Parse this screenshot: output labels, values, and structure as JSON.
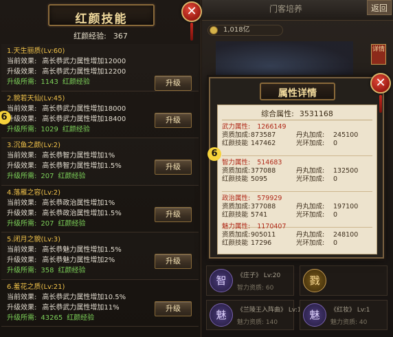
{
  "left_panel": {
    "title": "红颜技能",
    "exp_label": "红颜经验:",
    "exp_value": "367",
    "upgrade_label": "升级",
    "skills": [
      {
        "name": "1.天生丽质(Lv:60)",
        "current_label": "当前效果:",
        "current": "高长恭武力属性增加12000",
        "next_label": "升级效果:",
        "next": "高长恭武力属性增加12200",
        "need_label": "升级所需:",
        "need_value": "1143",
        "need_unit": "红颜经验"
      },
      {
        "name": "2.貌若天仙(Lv:45)",
        "current_label": "当前效果:",
        "current": "高长恭武力属性增加18000",
        "next_label": "升级效果:",
        "next": "高长恭武力属性增加18400",
        "need_label": "升级所需:",
        "need_value": "1029",
        "need_unit": "红颜经验"
      },
      {
        "name": "3.沉鱼之颜(Lv:2)",
        "current_label": "当前效果:",
        "current": "高长恭智力属性增加1%",
        "next_label": "升级效果:",
        "next": "高长恭智力属性增加1.5%",
        "need_label": "升级所需:",
        "need_value": "207",
        "need_unit": "红颜经验"
      },
      {
        "name": "4.落雁之容(Lv:2)",
        "current_label": "当前效果:",
        "current": "高长恭政治属性增加1%",
        "next_label": "升级效果:",
        "next": "高长恭政治属性增加1.5%",
        "need_label": "升级所需:",
        "need_value": "207",
        "need_unit": "红颜经验"
      },
      {
        "name": "5.闭月之貌(Lv:3)",
        "current_label": "当前效果:",
        "current": "高长恭魅力属性增加1.5%",
        "next_label": "升级效果:",
        "next": "高长恭魅力属性增加2%",
        "need_label": "升级所需:",
        "need_value": "358",
        "need_unit": "红颜经验"
      },
      {
        "name": "6.羞花之质(Lv:21)",
        "current_label": "当前效果:",
        "current": "高长恭武力属性增加10.5%",
        "next_label": "升级效果:",
        "next": "高长恭武力属性增加11%",
        "need_label": "升级所需:",
        "need_value": "43265",
        "need_unit": "红颜经验"
      }
    ]
  },
  "right_panel": {
    "bg_title": "门客培养",
    "back_label": "返回",
    "coins": "1,018亿",
    "detail_tag": "详情",
    "bottom_cards": [
      {
        "avatar": "智",
        "name": "《庄子》 Lv:20",
        "sub": "智力资质: 60"
      },
      {
        "avatar": "戮",
        "name": "",
        "sub": ""
      },
      {
        "avatar": "魅",
        "name": "《兰陵王入阵曲》 Lv:1",
        "sub": "魅力资质: 140"
      },
      {
        "avatar": "魅",
        "name": "《红妆》 Lv:1",
        "sub": "魅力资质: 40"
      }
    ]
  },
  "modal": {
    "title": "属性详情",
    "total_label": "综合属性:",
    "total_value": "3531168",
    "sections": [
      {
        "head_label": "武力属性:",
        "head_value": "1266149",
        "r1": [
          "资质加成:",
          "873587",
          "丹丸加成:",
          "245100"
        ],
        "r2": [
          "红颜技能",
          "147462",
          "光环加成:",
          "0"
        ]
      },
      {
        "head_label": "智力属性:",
        "head_value": "514683",
        "r1": [
          "资质加成:",
          "377088",
          "丹丸加成:",
          "132500"
        ],
        "r2": [
          "红颜技能",
          "5095",
          "光环加成:",
          "0"
        ]
      },
      {
        "head_label": "政治属性:",
        "head_value": "579929",
        "r1": [
          "资质加成:",
          "377088",
          "丹丸加成:",
          "197100"
        ],
        "r2": [
          "红颜技能",
          "5741",
          "光环加成:",
          "0"
        ]
      },
      {
        "head_label": "魅力属性:",
        "head_value": "1170407",
        "r1": [
          "资质加成:",
          "905011",
          "丹丸加成:",
          "248100"
        ],
        "r2": [
          "红颜技能",
          "17296",
          "光环加成:",
          "0"
        ]
      }
    ]
  },
  "colors": {
    "accent_gold": "#f0c24a",
    "need_green": "#7ed35a",
    "attr_red": "#b02818"
  },
  "icons": {
    "close": "close-icon",
    "coin": "coin-icon"
  }
}
